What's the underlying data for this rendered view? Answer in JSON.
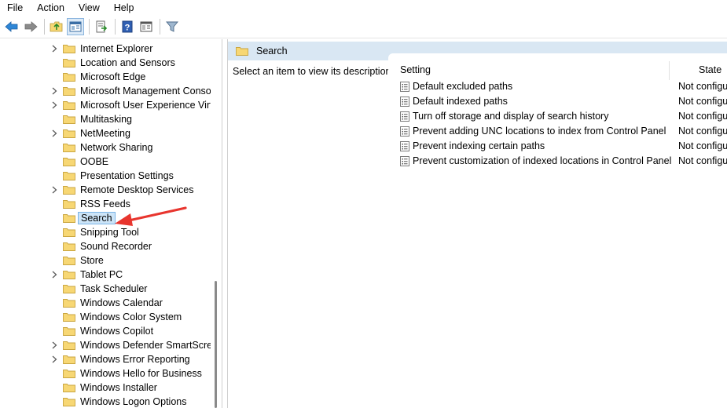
{
  "menubar": {
    "items": [
      "File",
      "Action",
      "View",
      "Help"
    ]
  },
  "toolbar": {
    "buttons": [
      "back-icon",
      "forward-icon",
      "up-folder-icon",
      "show-hide-tree-icon",
      "export-list-icon",
      "help-icon",
      "properties-icon",
      "filter-icon"
    ]
  },
  "tree": {
    "items": [
      {
        "label": "Internet Explorer",
        "expandable": true
      },
      {
        "label": "Location and Sensors",
        "expandable": false
      },
      {
        "label": "Microsoft Edge",
        "expandable": false
      },
      {
        "label": "Microsoft Management Conso",
        "expandable": true
      },
      {
        "label": "Microsoft User Experience Virt",
        "expandable": true
      },
      {
        "label": "Multitasking",
        "expandable": false
      },
      {
        "label": "NetMeeting",
        "expandable": true
      },
      {
        "label": "Network Sharing",
        "expandable": false
      },
      {
        "label": "OOBE",
        "expandable": false
      },
      {
        "label": "Presentation Settings",
        "expandable": false
      },
      {
        "label": "Remote Desktop Services",
        "expandable": true
      },
      {
        "label": "RSS Feeds",
        "expandable": false
      },
      {
        "label": "Search",
        "expandable": false,
        "selected": true
      },
      {
        "label": "Snipping Tool",
        "expandable": false
      },
      {
        "label": "Sound Recorder",
        "expandable": false
      },
      {
        "label": "Store",
        "expandable": false
      },
      {
        "label": "Tablet PC",
        "expandable": true
      },
      {
        "label": "Task Scheduler",
        "expandable": false
      },
      {
        "label": "Windows Calendar",
        "expandable": false
      },
      {
        "label": "Windows Color System",
        "expandable": false
      },
      {
        "label": "Windows Copilot",
        "expandable": false
      },
      {
        "label": "Windows Defender SmartScre",
        "expandable": true
      },
      {
        "label": "Windows Error Reporting",
        "expandable": true
      },
      {
        "label": "Windows Hello for Business",
        "expandable": false
      },
      {
        "label": "Windows Installer",
        "expandable": false
      },
      {
        "label": "Windows Logon Options",
        "expandable": false
      }
    ]
  },
  "right": {
    "header_title": "Search",
    "description": "Select an item to view its description.",
    "columns": {
      "setting": "Setting",
      "state": "State"
    },
    "settings": [
      {
        "name": "Default excluded paths",
        "state": "Not configu"
      },
      {
        "name": "Default indexed paths",
        "state": "Not configu"
      },
      {
        "name": "Turn off storage and display of search history",
        "state": "Not configu"
      },
      {
        "name": "Prevent adding UNC locations to index from Control Panel",
        "state": "Not configu"
      },
      {
        "name": "Prevent indexing certain paths",
        "state": "Not configu"
      },
      {
        "name": "Prevent customization of indexed locations in Control Panel",
        "state": "Not configu"
      }
    ]
  },
  "colors": {
    "annotation_arrow": "#e8352e",
    "folder_fill": "#f7d774",
    "selection_bg": "#cce4f7",
    "header_bg": "#d9e7f3"
  }
}
